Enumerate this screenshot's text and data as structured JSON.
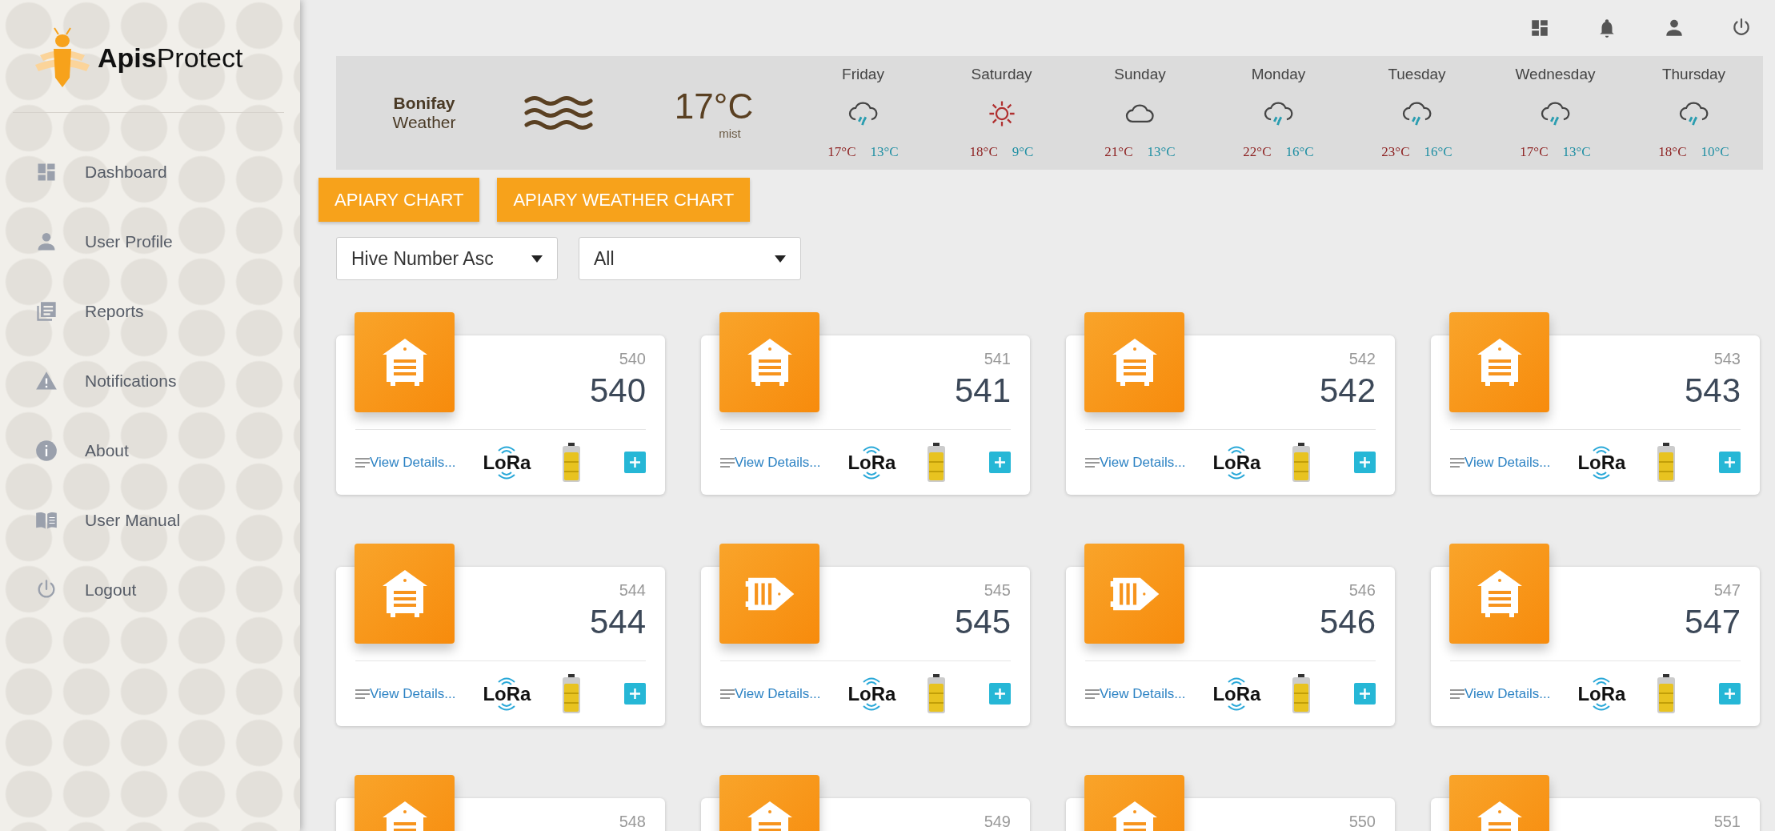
{
  "sidebar": {
    "logo": {
      "bold": "Apis",
      "regular": "Protect"
    },
    "items": [
      {
        "label": "Dashboard",
        "selected": false
      },
      {
        "label": "User Profile",
        "selected": false
      },
      {
        "label": "Reports",
        "selected": false
      },
      {
        "label": "Notifications",
        "selected": false
      },
      {
        "label": "About",
        "selected": false
      },
      {
        "label": "User Manual",
        "selected": false
      },
      {
        "label": "Logout",
        "selected": false
      }
    ]
  },
  "weather": {
    "location": "Bonifay",
    "label": "Weather",
    "temperature": "17°C",
    "condition": "mist",
    "forecast": [
      {
        "day": "Friday",
        "kind": "rain",
        "high": "17°C",
        "low": "13°C"
      },
      {
        "day": "Saturday",
        "kind": "sun",
        "high": "18°C",
        "low": "9°C"
      },
      {
        "day": "Sunday",
        "kind": "cloud",
        "high": "21°C",
        "low": "13°C"
      },
      {
        "day": "Monday",
        "kind": "rain",
        "high": "22°C",
        "low": "16°C"
      },
      {
        "day": "Tuesday",
        "kind": "rain",
        "high": "23°C",
        "low": "16°C"
      },
      {
        "day": "Wednesday",
        "kind": "rain",
        "high": "17°C",
        "low": "13°C"
      },
      {
        "day": "Thursday",
        "kind": "rain",
        "high": "18°C",
        "low": "10°C"
      }
    ]
  },
  "buttons": [
    "APIARY CHART",
    "APIARY WEATHER CHART"
  ],
  "filters": [
    {
      "value": "Hive Number Asc"
    },
    {
      "value": "All"
    }
  ],
  "hives": [
    {
      "kind": "front",
      "caption": "540",
      "number": "540",
      "link": "View Details...",
      "network": "LoRa"
    },
    {
      "kind": "front",
      "caption": "541",
      "number": "541",
      "link": "View Details...",
      "network": "LoRa"
    },
    {
      "kind": "front",
      "caption": "542",
      "number": "542",
      "link": "View Details...",
      "network": "LoRa"
    },
    {
      "kind": "front",
      "caption": "543",
      "number": "543",
      "link": "View Details...",
      "network": "LoRa"
    },
    {
      "kind": "front",
      "caption": "544",
      "number": "544",
      "link": "View Details...",
      "network": "LoRa"
    },
    {
      "kind": "side",
      "caption": "545",
      "number": "545",
      "link": "View Details...",
      "network": "LoRa"
    },
    {
      "kind": "side",
      "caption": "546",
      "number": "546",
      "link": "View Details...",
      "network": "LoRa"
    },
    {
      "kind": "front",
      "caption": "547",
      "number": "547",
      "link": "View Details...",
      "network": "LoRa"
    },
    {
      "kind": "front",
      "caption": "548"
    },
    {
      "kind": "front",
      "caption": "549"
    },
    {
      "kind": "front",
      "caption": "550"
    },
    {
      "kind": "front",
      "caption": "551"
    }
  ]
}
